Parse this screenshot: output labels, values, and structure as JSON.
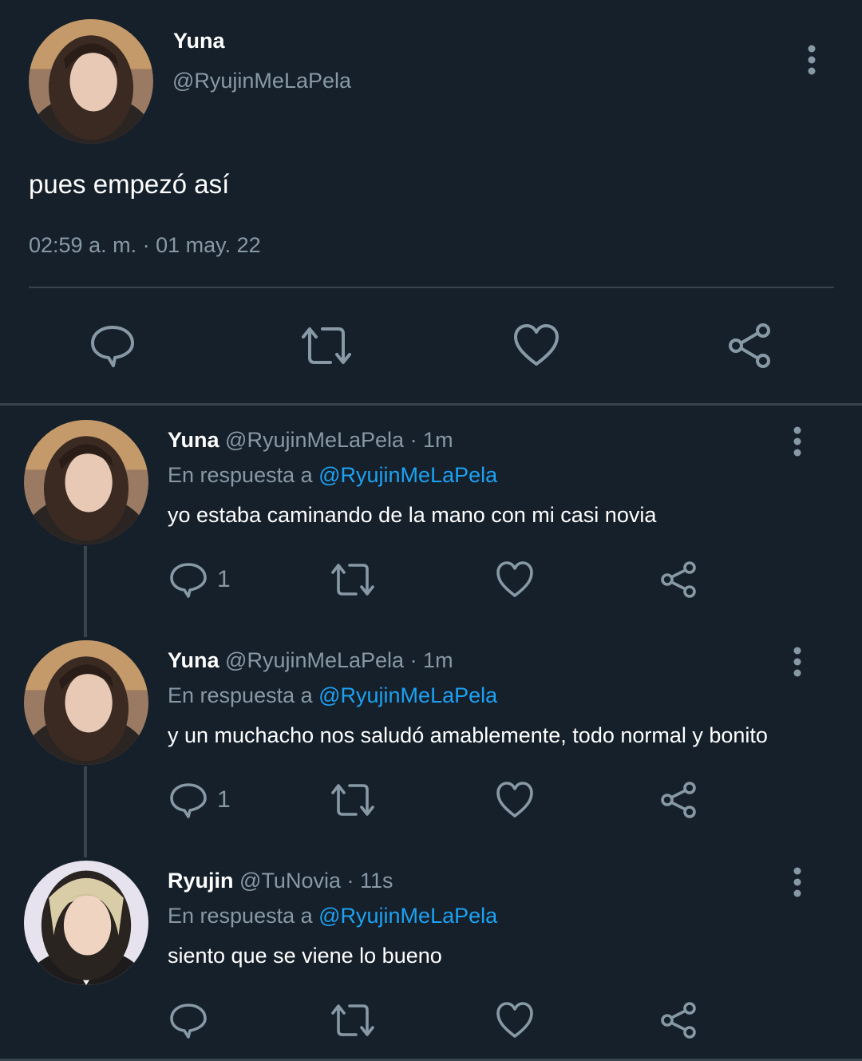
{
  "main_tweet": {
    "name": "Yuna",
    "handle": "@RyujinMeLaPela",
    "text": "pues empezó así",
    "timestamp": "02:59 a. m. · 01 may. 22"
  },
  "replies": [
    {
      "name": "Yuna",
      "handle_time": "@RyujinMeLaPela · 1m",
      "in_reply_prefix": "En respuesta a ",
      "in_reply_mention": "@RyujinMeLaPela",
      "text": "yo estaba caminando de la mano con mi casi novia",
      "reply_count": "1"
    },
    {
      "name": "Yuna",
      "handle_time": "@RyujinMeLaPela · 1m",
      "in_reply_prefix": "En respuesta a ",
      "in_reply_mention": "@RyujinMeLaPela",
      "text": "y un muchacho nos saludó amablemente, todo normal y bonito",
      "reply_count": "1"
    },
    {
      "name": "Ryujin",
      "handle_time": "@TuNovia · 11s",
      "in_reply_prefix": "En respuesta a ",
      "in_reply_mention": "@RyujinMeLaPela",
      "text": "siento que se viene lo bueno",
      "reply_count": ""
    }
  ],
  "icons": {
    "reply": "speech-bubble-icon",
    "retweet": "retweet-icon",
    "like": "heart-icon",
    "share": "share-icon",
    "more": "more-vertical-icon"
  },
  "colors": {
    "background": "#15202b",
    "divider": "#38444d",
    "secondary_text": "#8899a6",
    "mention": "#1da1f2",
    "icon": "#8899a6"
  }
}
